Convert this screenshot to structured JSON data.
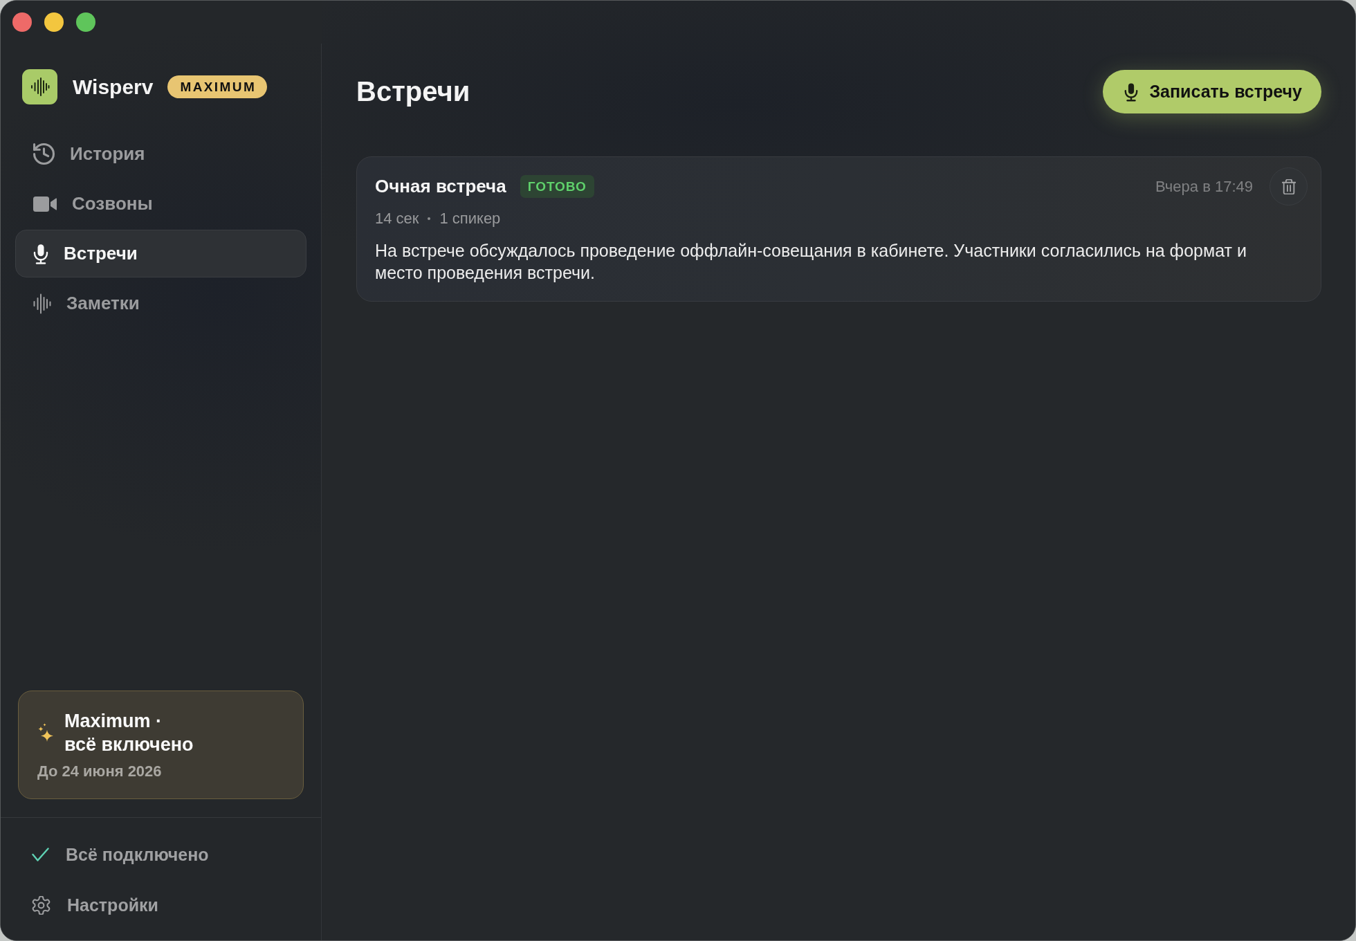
{
  "app": {
    "name": "Wisperv",
    "plan_badge": "MAXIMUM"
  },
  "sidebar": {
    "items": [
      {
        "kind": "history",
        "label": "История",
        "selected": false
      },
      {
        "kind": "calls",
        "label": "Созвоны",
        "selected": false
      },
      {
        "kind": "meetings",
        "label": "Встречи",
        "selected": true
      },
      {
        "kind": "notes",
        "label": "Заметки",
        "selected": false
      }
    ],
    "plan_card": {
      "title_lines": [
        "Maximum ·",
        "всё включено"
      ],
      "expiry": "До 24 июня 2026"
    },
    "footer": [
      {
        "kind": "status",
        "label": "Всё подключено"
      },
      {
        "kind": "settings",
        "label": "Настройки"
      }
    ]
  },
  "page": {
    "title": "Встречи",
    "record_button": "Записать встречу"
  },
  "meetings": [
    {
      "title": "Очная встреча",
      "status": "ГОТОВО",
      "meta": [
        "14 сек",
        "1 спикер"
      ],
      "time": "Вчера в 17:49",
      "summary": "На встрече обсуждалось проведение оффлайн-совещания в кабинете. Участники согласились на формат и место проведения встречи."
    }
  ]
}
